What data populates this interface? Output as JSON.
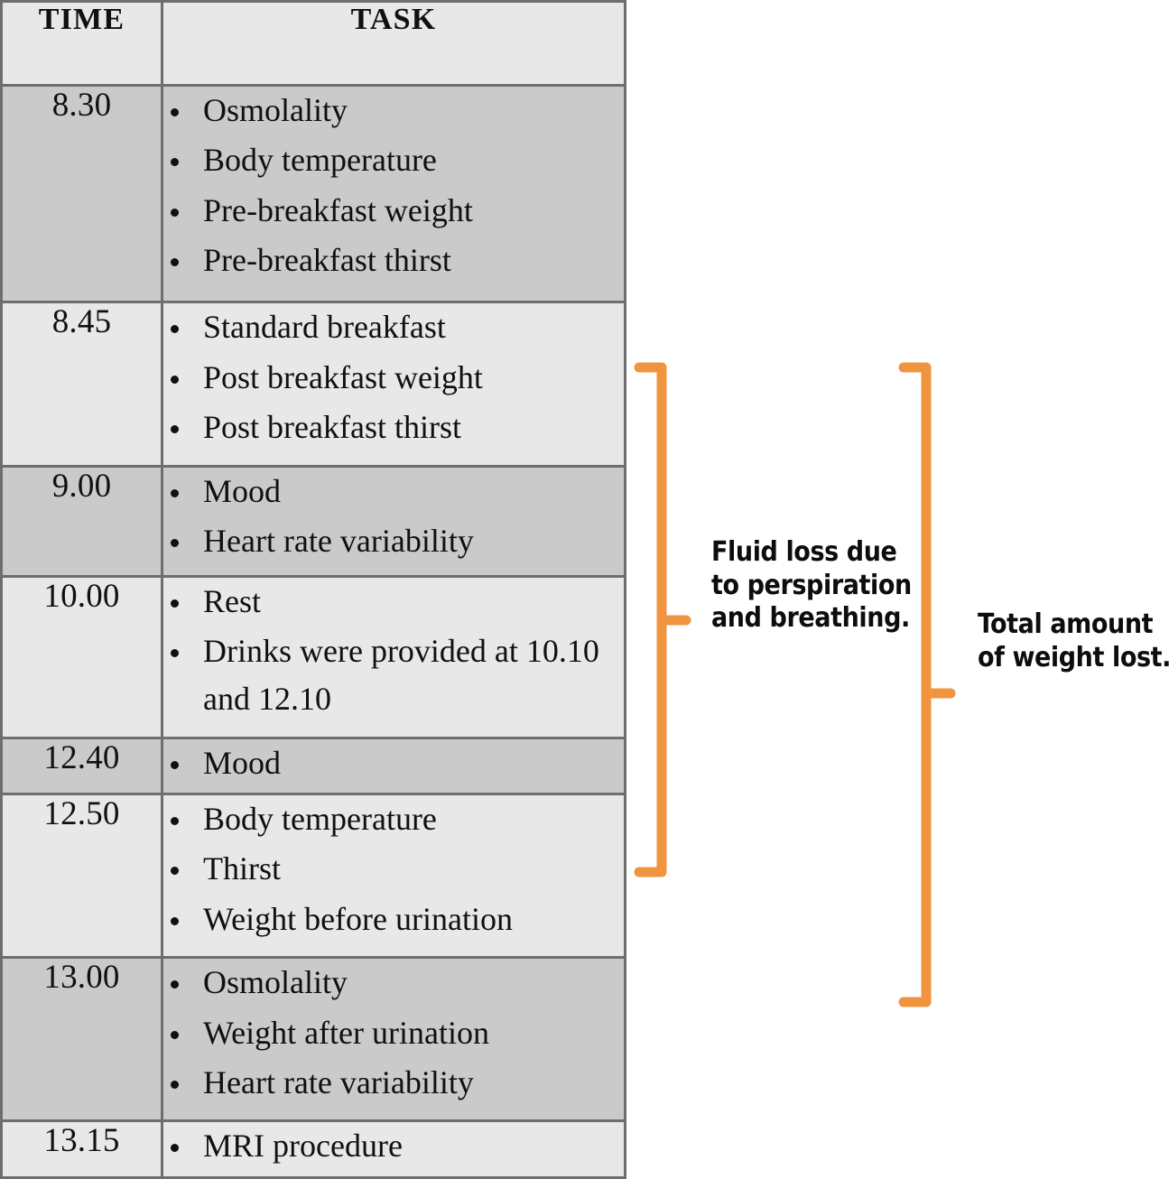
{
  "table": {
    "columns": [
      {
        "key": "time",
        "label": "TIME"
      },
      {
        "key": "task",
        "label": "TASK"
      }
    ],
    "rows": [
      {
        "time": "8.30",
        "tasks": [
          "Osmolality",
          "Body temperature",
          "Pre-breakfast weight",
          "Pre-breakfast thirst"
        ]
      },
      {
        "time": "8.45",
        "tasks": [
          "Standard breakfast",
          "Post breakfast weight",
          "Post breakfast thirst"
        ]
      },
      {
        "time": "9.00",
        "tasks": [
          "Mood",
          "Heart rate variability"
        ]
      },
      {
        "time": "10.00",
        "tasks": [
          "Rest",
          "Drinks were provided at 10.10 and 12.10"
        ]
      },
      {
        "time": "12.40",
        "tasks": [
          "Mood"
        ]
      },
      {
        "time": "12.50",
        "tasks": [
          "Body temperature",
          "Thirst",
          "Weight before urination"
        ]
      },
      {
        "time": "13.00",
        "tasks": [
          "Osmolality",
          "Weight after urination",
          "Heart rate variability"
        ]
      },
      {
        "time": "13.15",
        "tasks": [
          "MRI procedure"
        ]
      }
    ]
  },
  "annotations": {
    "bracket_color": "#F09440",
    "items": [
      {
        "id": "perspiration",
        "text": "Fluid loss due to perspiration and breathing."
      },
      {
        "id": "total-weight",
        "text": "Total amount of weight lost."
      }
    ]
  }
}
